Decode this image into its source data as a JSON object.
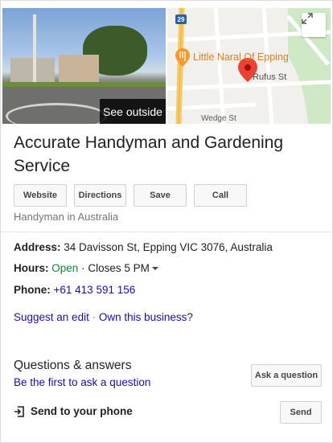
{
  "media": {
    "see_outside_label": "See outside",
    "map": {
      "highway_number": "29",
      "poi_label": "Little Naral Of Epping",
      "street_1": "Rufus St",
      "street_2": "Wedge St"
    }
  },
  "business": {
    "name": "Accurate Handyman and Gardening Service",
    "category": "Handyman in Australia"
  },
  "actions": [
    {
      "label": "Website"
    },
    {
      "label": "Directions"
    },
    {
      "label": "Save"
    },
    {
      "label": "Call"
    }
  ],
  "details": {
    "address_label": "Address:",
    "address_value": "34 Davisson St, Epping VIC 3076, Australia",
    "hours_label": "Hours:",
    "hours_status": "Open",
    "hours_separator": "·",
    "hours_closes": "Closes 5 PM",
    "phone_label": "Phone:",
    "phone_value": "+61 413 591 156"
  },
  "edit_links": {
    "suggest_edit": "Suggest an edit",
    "separator": "·",
    "own_business": "Own this business?"
  },
  "qa": {
    "title": "Questions & answers",
    "first_to_ask": "Be the first to ask a question",
    "ask_button": "Ask a question"
  },
  "send_to_phone": {
    "label": "Send to your phone",
    "button": "Send"
  },
  "colors": {
    "link": "#1a0dab",
    "open": "#188038",
    "map_pin": "#ea4335",
    "poi": "#e67c14"
  }
}
